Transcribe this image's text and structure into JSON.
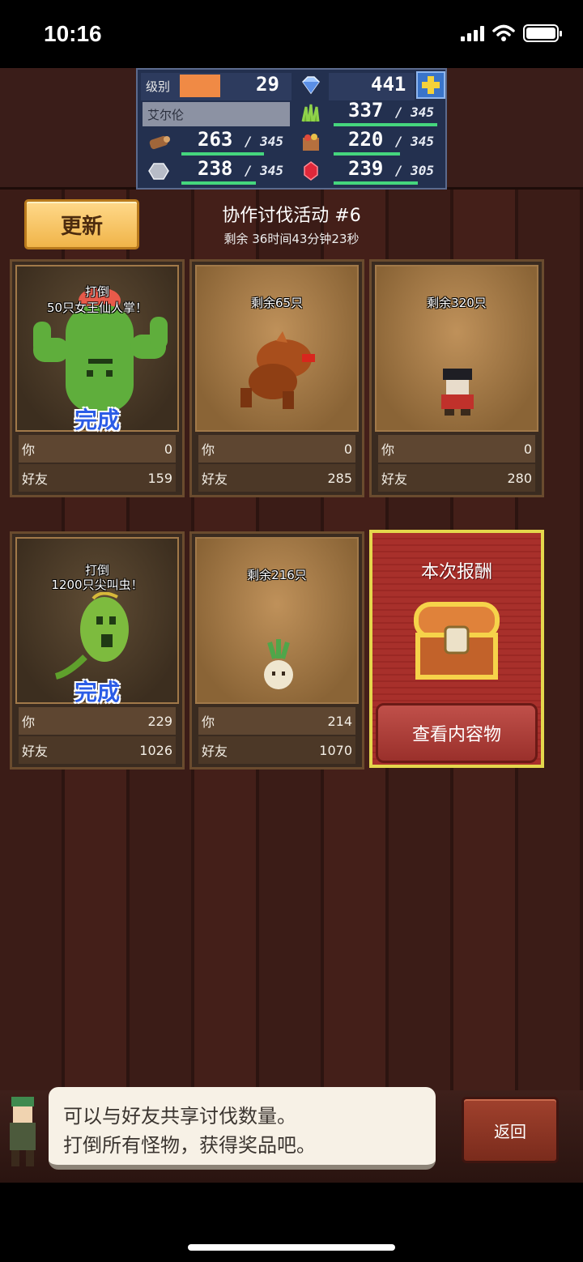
{
  "status_bar": {
    "time": "10:16"
  },
  "resources": {
    "level_label": "级别",
    "level": "29",
    "gems": "441",
    "player_name": "艾尔伦",
    "grass": {
      "value": "337",
      "max": "345"
    },
    "wood": {
      "value": "263",
      "max": "345"
    },
    "food": {
      "value": "220",
      "max": "345"
    },
    "ore": {
      "value": "238",
      "max": "345"
    },
    "ruby": {
      "value": "239",
      "max": "305"
    }
  },
  "header": {
    "refresh_label": "更新",
    "event_title": "协作讨伐活动 #6",
    "remaining": "剩余 36时间43分钟23秒"
  },
  "stat_labels": {
    "you": "你",
    "friends": "好友"
  },
  "cards": [
    {
      "line1": "打倒",
      "line2": "50只女王仙人掌！",
      "complete": "完成",
      "you": "0",
      "friends": "159"
    },
    {
      "line1": "剩余65只",
      "you": "0",
      "friends": "285"
    },
    {
      "line1": "剩余320只",
      "you": "0",
      "friends": "280"
    },
    {
      "line1": "打倒",
      "line2": "1200只尖叫虫！",
      "complete": "完成",
      "you": "229",
      "friends": "1026"
    },
    {
      "line1": "剩余216只",
      "you": "214",
      "friends": "1070"
    }
  ],
  "reward": {
    "title": "本次报酬",
    "view_label": "查看内容物"
  },
  "dialog": {
    "line1": "可以与好友共享讨伐数量。",
    "line2": "打倒所有怪物，获得奖品吧。"
  },
  "back_label": "返回",
  "colors": {
    "accent_gold": "#f0b449",
    "reward_red": "#a8302b",
    "complete_blue": "#2b5ce6",
    "bar_green": "#45d67d"
  }
}
